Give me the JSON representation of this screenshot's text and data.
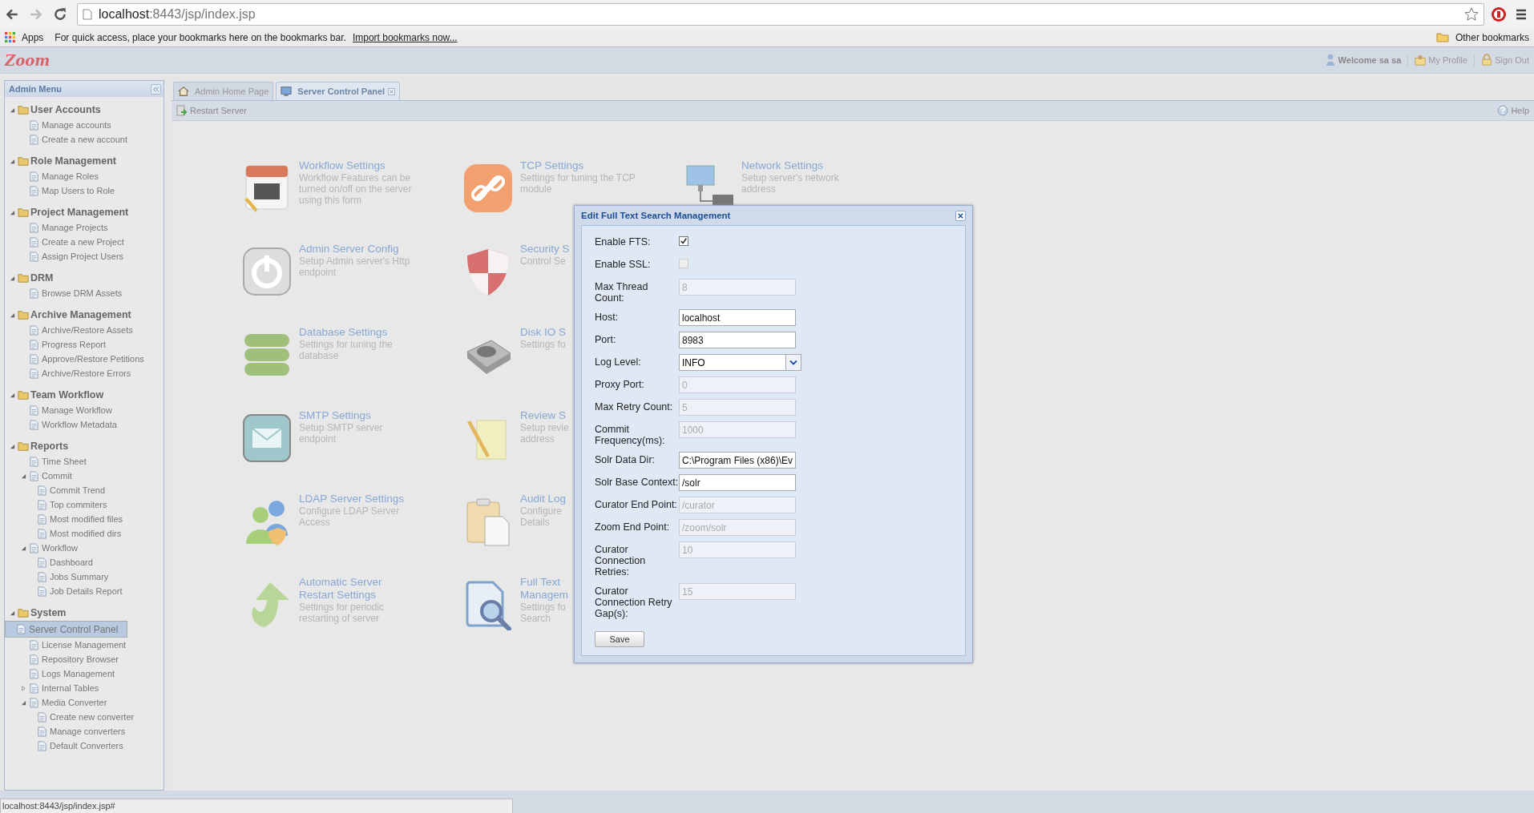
{
  "browser": {
    "url_host": "localhost",
    "url_path": ":8443/jsp/index.jsp",
    "apps": "Apps",
    "bookmarks_hint": "For quick access, place your bookmarks here on the bookmarks bar.",
    "import_link": "Import bookmarks now...",
    "other_bookmarks": "Other bookmarks"
  },
  "header": {
    "logo": "Zoom",
    "welcome": "Welcome sa sa",
    "links": [
      "My Profile",
      "Sign Out"
    ]
  },
  "sidebar": {
    "title": "Admin Menu",
    "groups": [
      {
        "label": "User Accounts",
        "expanded": true,
        "items": [
          {
            "label": "Manage accounts",
            "selected": false
          },
          {
            "label": "Create a new account",
            "selected": false
          }
        ]
      },
      {
        "label": "Role Management",
        "expanded": true,
        "items": [
          {
            "label": "Manage Roles",
            "selected": false
          },
          {
            "label": "Map Users to Role",
            "selected": false
          }
        ]
      },
      {
        "label": "Project Management",
        "expanded": true,
        "items": [
          {
            "label": "Manage Projects",
            "selected": false
          },
          {
            "label": "Create a new Project",
            "selected": false
          },
          {
            "label": "Assign Project Users",
            "selected": false
          }
        ]
      },
      {
        "label": "DRM",
        "expanded": true,
        "items": [
          {
            "label": "Browse DRM Assets",
            "selected": false
          }
        ]
      },
      {
        "label": "Archive Management",
        "expanded": true,
        "items": [
          {
            "label": "Archive/Restore Assets",
            "selected": false
          },
          {
            "label": "Progress Report",
            "selected": false
          },
          {
            "label": "Approve/Restore Petitions",
            "selected": false
          },
          {
            "label": "Archive/Restore Errors",
            "selected": false
          }
        ]
      },
      {
        "label": "Team Workflow",
        "expanded": true,
        "items": [
          {
            "label": "Manage Workflow",
            "selected": false
          },
          {
            "label": "Workflow Metadata",
            "selected": false
          }
        ]
      },
      {
        "label": "Reports",
        "expanded": true,
        "items": [
          {
            "label": "Time Sheet",
            "selected": false
          },
          {
            "label": "Commit",
            "selected": false,
            "expanded": true,
            "children": [
              {
                "label": "Commit Trend",
                "selected": false
              },
              {
                "label": "Top commiters",
                "selected": false
              },
              {
                "label": "Most modified files",
                "selected": false
              },
              {
                "label": "Most modified dirs",
                "selected": false
              }
            ]
          },
          {
            "label": "Workflow",
            "selected": false,
            "expanded": true,
            "children": [
              {
                "label": "Dashboard",
                "selected": false
              },
              {
                "label": "Jobs Summary",
                "selected": false
              },
              {
                "label": "Job Details Report",
                "selected": false
              }
            ]
          }
        ]
      },
      {
        "label": "System",
        "expanded": true,
        "items": [
          {
            "label": "Server Control Panel",
            "selected": true
          },
          {
            "label": "License Management",
            "selected": false
          },
          {
            "label": "Repository Browser",
            "selected": false
          },
          {
            "label": "Logs Management",
            "selected": false
          },
          {
            "label": "Internal Tables",
            "selected": false,
            "expanded": false
          },
          {
            "label": "Media Converter",
            "selected": false,
            "expanded": true,
            "children": [
              {
                "label": "Create new converter",
                "selected": false
              },
              {
                "label": "Manage converters",
                "selected": false
              },
              {
                "label": "Default Converters",
                "selected": false
              }
            ]
          }
        ]
      }
    ]
  },
  "tabs": [
    {
      "label": "Admin Home Page",
      "selected": false,
      "closable": false
    },
    {
      "label": "Server Control Panel",
      "selected": true,
      "closable": true
    }
  ],
  "toolbar": {
    "action": "Restart Server",
    "help": "Help"
  },
  "tile_rows": [
    [
      {
        "title": "Workflow Settings",
        "description": "Workflow Features can be\nturned on/off on the server\nusing this form"
      },
      {
        "title": "TCP Settings",
        "description": "Settings for tuning the TCP\nmodule"
      },
      {
        "title": "Network Settings",
        "description": "Setup server's network\naddress"
      }
    ],
    [
      {
        "title": "Admin Server Config",
        "description": "Setup Admin server's Http\nendpoint"
      },
      {
        "title": "Security S",
        "description": "Control Se"
      }
    ],
    [
      {
        "title": "Database Settings",
        "description": "Settings for tuning the\ndatabase"
      },
      {
        "title": "Disk IO S",
        "description": "Settings fo"
      }
    ],
    [
      {
        "title": "SMTP Settings",
        "description": "Setup SMTP server\nendpoint"
      },
      {
        "title": "Review S",
        "description": "Setup revie\naddress"
      }
    ],
    [
      {
        "title": "LDAP Server Settings",
        "description": "Configure LDAP Server\nAccess"
      },
      {
        "title": "Audit Log",
        "description": "Configure\nDetails"
      }
    ],
    [
      {
        "title": "Automatic Server\nRestart Settings",
        "description": "Settings for periodic\nrestarting of server"
      },
      {
        "title": "Full Text\nManagem",
        "description": "Settings fo\nSearch"
      }
    ]
  ],
  "dialog": {
    "title": "Edit Full Text Search Management",
    "fields": [
      {
        "kind": "checkbox",
        "label": "Enable FTS:",
        "checked": true,
        "disabled": false
      },
      {
        "kind": "checkbox",
        "label": "Enable SSL:",
        "checked": false,
        "disabled": true
      },
      {
        "kind": "text",
        "label": "Max Thread Count:",
        "value": "8",
        "disabled": true
      },
      {
        "kind": "text",
        "label": "Host:",
        "value": "localhost",
        "disabled": false
      },
      {
        "kind": "text",
        "label": "Port:",
        "value": "8983",
        "disabled": false
      },
      {
        "kind": "select",
        "label": "Log Level:",
        "value": "INFO",
        "disabled": false
      },
      {
        "kind": "text",
        "label": "Proxy Port:",
        "value": "0",
        "disabled": true
      },
      {
        "kind": "text",
        "label": "Max Retry Count:",
        "value": "5",
        "disabled": true
      },
      {
        "kind": "text",
        "label": "Commit Frequency(ms):",
        "value": "1000",
        "disabled": true
      },
      {
        "kind": "text",
        "label": "Solr Data Dir:",
        "value": "C:\\Program Files (x86)\\Ev",
        "disabled": false
      },
      {
        "kind": "text",
        "label": "Solr Base Context:",
        "value": "/solr",
        "disabled": false
      },
      {
        "kind": "text",
        "label": "Curator End Point:",
        "value": "/curator",
        "disabled": true
      },
      {
        "kind": "text",
        "label": "Zoom End Point:",
        "value": "/zoom/solr",
        "disabled": true
      },
      {
        "kind": "text",
        "label": "Curator Connection Retries:",
        "value": "10",
        "disabled": true
      },
      {
        "kind": "text",
        "label": "Curator Connection Retry Gap(s):",
        "value": "15",
        "disabled": true
      }
    ],
    "save": "Save"
  },
  "status_url": "localhost:8443/jsp/index.jsp#"
}
